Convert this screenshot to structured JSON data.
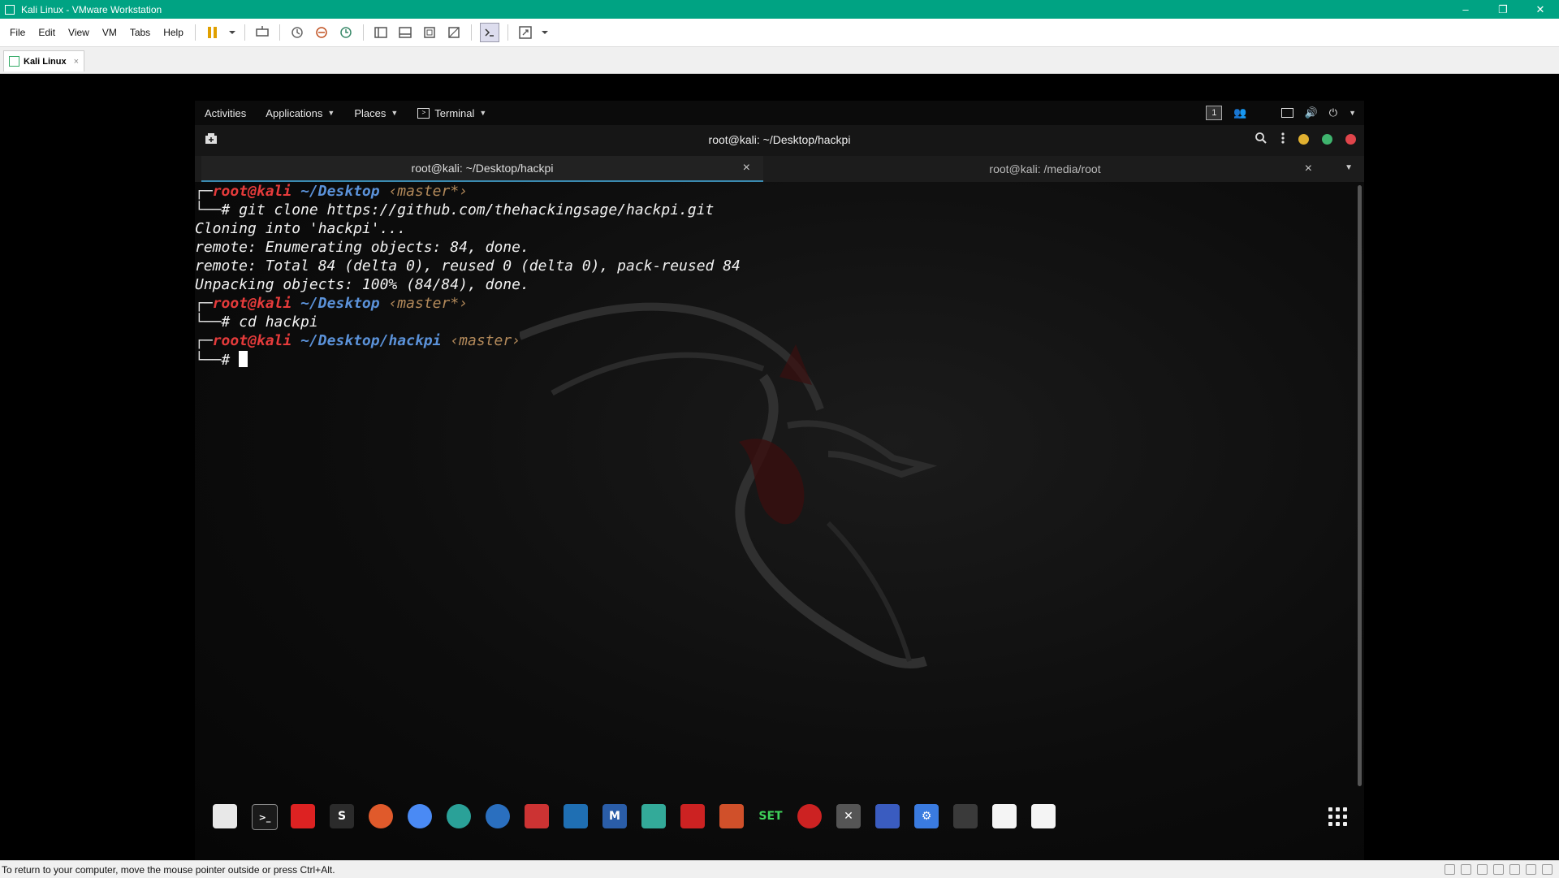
{
  "window": {
    "title": "Kali Linux - VMware Workstation",
    "controls": [
      "–",
      "❐",
      "✕"
    ]
  },
  "menubar": {
    "items": [
      "File",
      "Edit",
      "View",
      "VM",
      "Tabs",
      "Help"
    ]
  },
  "vm_tab": {
    "label": "Kali Linux",
    "close": "×"
  },
  "gnome_bar": {
    "activities": "Activities",
    "applications": "Applications",
    "places": "Places",
    "terminal": "Terminal",
    "workspace": "1"
  },
  "terminal": {
    "title": "root@kali: ~/Desktop/hackpi",
    "tabs": [
      {
        "label": "root@kali: ~/Desktop/hackpi",
        "active": true,
        "close": "×"
      },
      {
        "label": "root@kali: /media/root",
        "active": false,
        "close": "×"
      }
    ],
    "lines": {
      "p1_user": "root@kali",
      "p1_path": "~/Desktop",
      "p1_branch": "‹master*›",
      "cmd1": "# git clone https://github.com/thehackingsage/hackpi.git",
      "out1": "Cloning into 'hackpi'...",
      "out2": "remote: Enumerating objects: 84, done.",
      "out3": "remote: Total 84 (delta 0), reused 0 (delta 0), pack-reused 84",
      "out4": "Unpacking objects: 100% (84/84), done.",
      "p2_user": "root@kali",
      "p2_path": "~/Desktop",
      "p2_branch": "‹master*›",
      "cmd2": "# cd hackpi",
      "p3_user": "root@kali",
      "p3_path": "~/Desktop/hackpi",
      "p3_branch": "‹master›",
      "cmd3": "#"
    }
  },
  "dock": {
    "items": [
      {
        "name": "files",
        "color": "#e8e8e8",
        "glyph": ""
      },
      {
        "name": "terminal",
        "color": "#1a1a1a",
        "glyph": ">_"
      },
      {
        "name": "red-app",
        "color": "#d22",
        "glyph": ""
      },
      {
        "name": "sublime",
        "color": "#2b2b2b",
        "glyph": "S"
      },
      {
        "name": "firefox",
        "color": "#e05a2b",
        "glyph": ""
      },
      {
        "name": "chrome",
        "color": "#4a8af4",
        "glyph": ""
      },
      {
        "name": "network",
        "color": "#2aa198",
        "glyph": ""
      },
      {
        "name": "eye",
        "color": "#2a6fbf",
        "glyph": ""
      },
      {
        "name": "burp",
        "color": "#c33",
        "glyph": ""
      },
      {
        "name": "wireshark",
        "color": "#1f6fb3",
        "glyph": ""
      },
      {
        "name": "metasploit",
        "color": "#2a5da8",
        "glyph": "M"
      },
      {
        "name": "beef",
        "color": "#3a9",
        "glyph": ""
      },
      {
        "name": "red-hat",
        "color": "#c22",
        "glyph": ""
      },
      {
        "name": "zaproxy",
        "color": "#d0502a",
        "glyph": ""
      },
      {
        "name": "set",
        "color": "#2c2c2c",
        "glyph": "SET"
      },
      {
        "name": "wifi-tool",
        "color": "#c22",
        "glyph": ""
      },
      {
        "name": "crossed-tool",
        "color": "#555",
        "glyph": "✕"
      },
      {
        "name": "screen-tool",
        "color": "#3a5cc0",
        "glyph": ""
      },
      {
        "name": "settings",
        "color": "#3a7be0",
        "glyph": "⚙"
      },
      {
        "name": "tweaks",
        "color": "#3a3a3a",
        "glyph": ""
      },
      {
        "name": "usb-1",
        "color": "#f4f4f4",
        "glyph": ""
      },
      {
        "name": "usb-2",
        "color": "#f4f4f4",
        "glyph": ""
      }
    ]
  },
  "statusbar": {
    "message": "To return to your computer, move the mouse pointer outside or press Ctrl+Alt."
  }
}
